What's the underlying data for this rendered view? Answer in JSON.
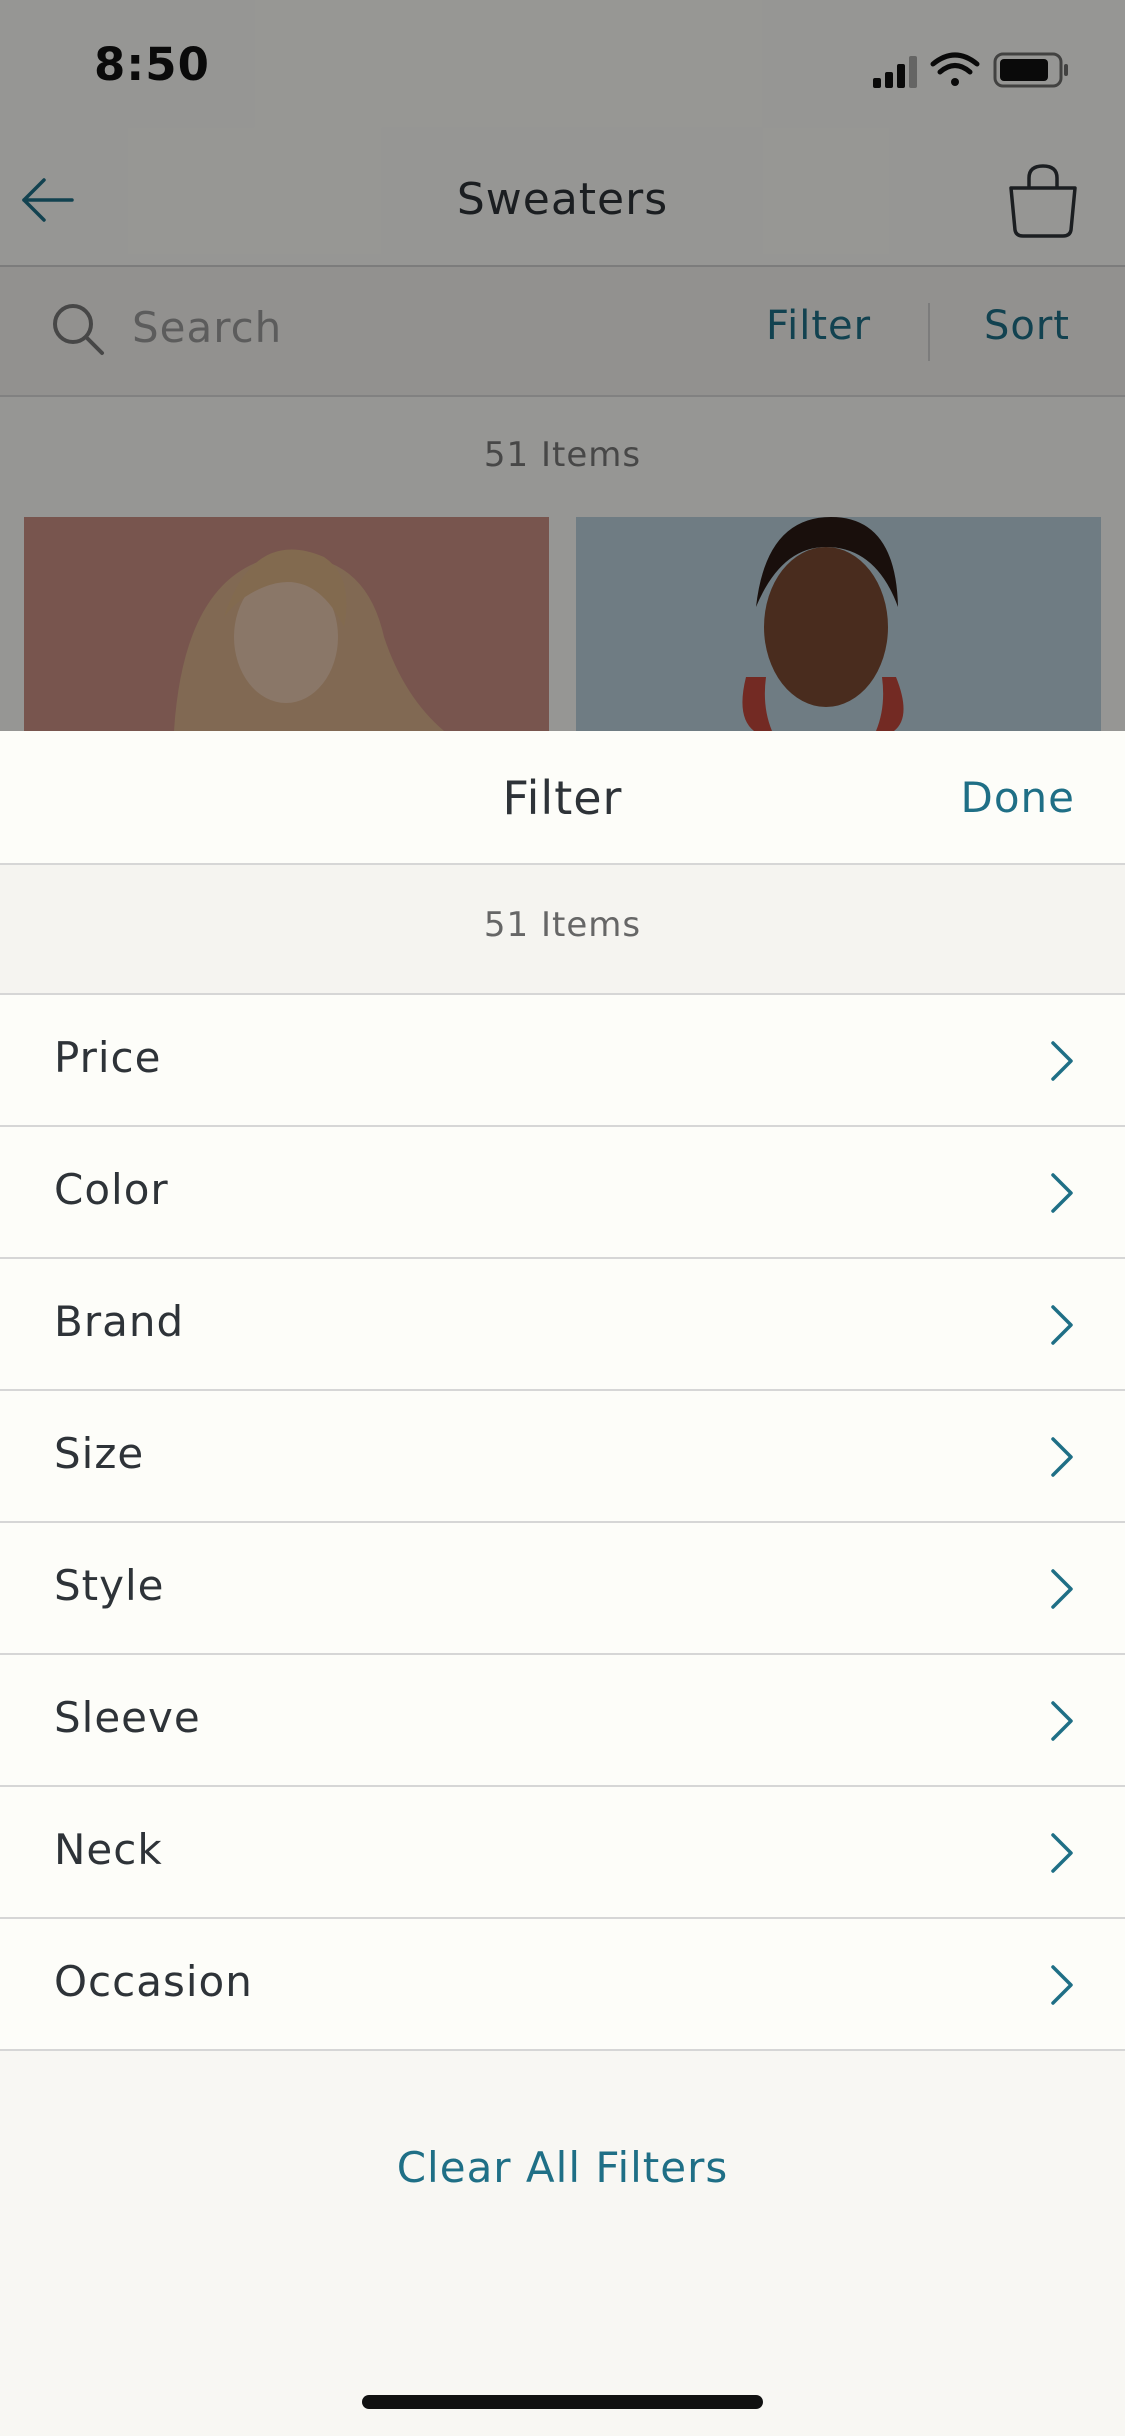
{
  "status_bar": {
    "time": "8:50"
  },
  "nav": {
    "title": "Sweaters",
    "back_icon": "arrow-left-icon",
    "bag_icon": "shopping-bag-icon"
  },
  "search": {
    "placeholder": "Search",
    "filter_label": "Filter",
    "sort_label": "Sort"
  },
  "product_grid": {
    "count_text": "51 Items"
  },
  "filter_sheet": {
    "title": "Filter",
    "done_label": "Done",
    "count_text": "51 Items",
    "options": [
      {
        "label": "Price"
      },
      {
        "label": "Color"
      },
      {
        "label": "Brand"
      },
      {
        "label": "Size"
      },
      {
        "label": "Style"
      },
      {
        "label": "Sleeve"
      },
      {
        "label": "Neck"
      },
      {
        "label": "Occasion"
      }
    ],
    "clear_all_label": "Clear All Filters"
  },
  "colors": {
    "accent": "#1f6f86",
    "text": "#2e3338",
    "divider": "#d6d6d6",
    "sheet_bg": "#fdfdf9"
  }
}
